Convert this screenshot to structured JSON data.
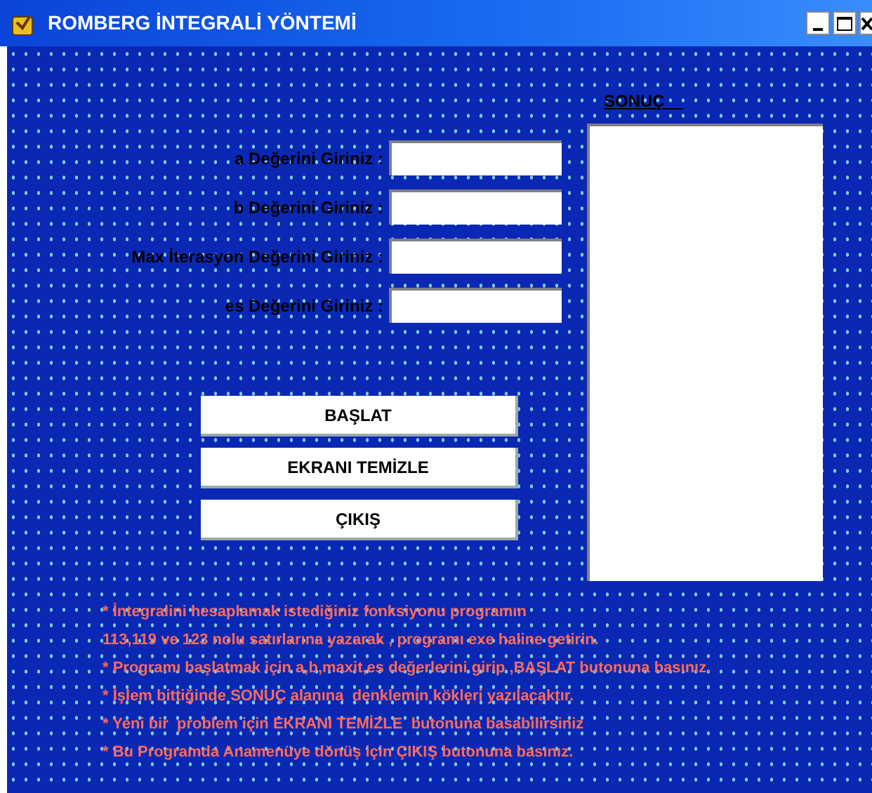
{
  "window": {
    "title": "ROMBERG İNTEGRALİ YÖNTEMİ"
  },
  "fields": [
    {
      "label": "a Değerini Giriniz :"
    },
    {
      "label": "b Değerini Giriniz :"
    },
    {
      "label": "Max İterasyon Değerini Giriniz :"
    },
    {
      "label": "es Değerini Giriniz :"
    }
  ],
  "buttons": [
    "BAŞLAT",
    "EKRANI TEMİZLE",
    "ÇIKIŞ"
  ],
  "result": {
    "label": "SONUÇ    "
  },
  "notes": [
    {
      "text": "* İntegralini hesaplamak istediğiniz fonksiyonu programın"
    },
    {
      "text": "113,119 ve 123 nolu satırlarına yazarak , programı exe haline getirin."
    },
    {
      "text": "* Programı başlatmak için a,b,maxit,es değerlerini girip ,BAŞLAT butonuna basınız."
    },
    {
      "text": "* İşlem bittiğinde SONUÇ alanına  denklemin kökleri yazılacaktır."
    },
    {
      "text": "* Yeni bir  problem için EKRANI TEMİZLE  butonuna basabilirsiniz"
    },
    {
      "text": "* Bu Programda Anamenüye dönüş için ÇIKIŞ butonuna basınız."
    }
  ]
}
